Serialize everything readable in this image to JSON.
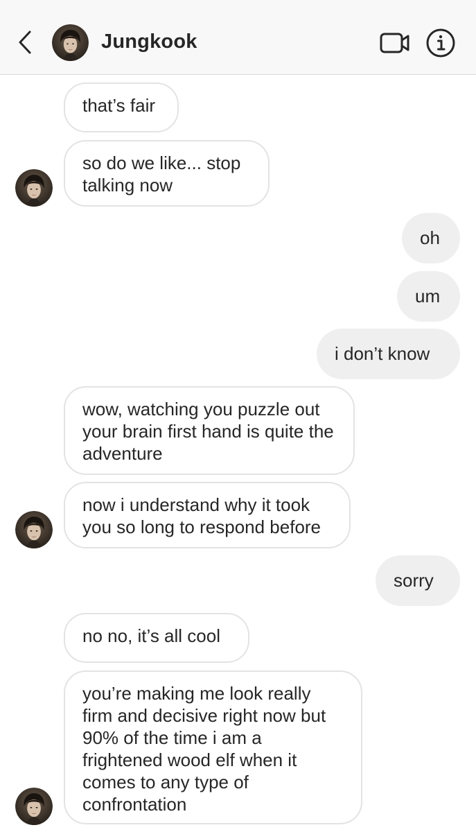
{
  "header": {
    "contact_name": "Jungkook",
    "back_icon": "chevron-left-icon",
    "video_icon": "video-camera-icon",
    "info_icon": "info-icon"
  },
  "colors": {
    "incoming_border": "#e3e3e3",
    "outgoing_bg": "#efefef",
    "header_bg": "#f8f8f8",
    "text": "#262626"
  },
  "messages": [
    {
      "from": "them",
      "text": "that’s fair"
    },
    {
      "from": "them",
      "text": "so do we like... stop talking now"
    },
    {
      "from": "me",
      "text": "oh"
    },
    {
      "from": "me",
      "text": "um"
    },
    {
      "from": "me",
      "text": "i don’t know"
    },
    {
      "from": "them",
      "text": "wow, watching you puzzle out your brain first hand is quite the adventure"
    },
    {
      "from": "them",
      "text": "now i understand why it took you so long to respond before"
    },
    {
      "from": "me",
      "text": "sorry"
    },
    {
      "from": "them",
      "text": "no no, it’s all cool"
    },
    {
      "from": "them",
      "text": "you’re making me look really firm and decisive right now but 90% of the time i am a frightened wood elf when it comes to any type of confrontation"
    }
  ]
}
